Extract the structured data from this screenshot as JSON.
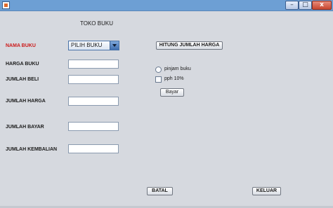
{
  "window": {
    "title": "",
    "controls": {
      "minimize": "–",
      "maximize": "□",
      "close": "x"
    }
  },
  "form": {
    "heading": "TOKO BUKU",
    "labels": {
      "nama_buku": "NAMA BUKU",
      "harga_buku": "HARGA BUKU",
      "jumlah_beli": "JUMLAH BELI",
      "jumlah_harga": "JUMLAH HARGA",
      "jumlah_bayar": "JUMLAH BAYAR",
      "jumlah_kembalian": "JUMLAH KEMBALIAN"
    },
    "nama_buku_select": {
      "selected": "PILIH BUKU"
    },
    "fields": {
      "harga_buku": "",
      "jumlah_beli": "",
      "jumlah_harga": "",
      "jumlah_bayar": "",
      "jumlah_kembalian": ""
    },
    "buttons": {
      "hitung": "HITUNG JUMLAH HARGA",
      "bayar": "Bayar",
      "batal": "BATAL",
      "keluar": "KELUAR"
    },
    "options": {
      "pinjam_buku": "pinjam buku",
      "pph": "pph 10%"
    }
  },
  "colors": {
    "label_highlight": "#cc1a1a",
    "window_bg": "#d6d9df",
    "titlebar": "#6d9fd4"
  }
}
